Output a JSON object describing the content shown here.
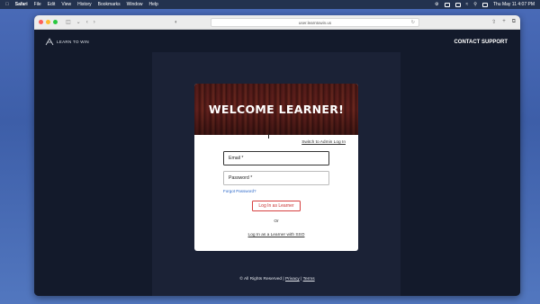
{
  "menubar": {
    "items": [
      "Safari",
      "File",
      "Edit",
      "View",
      "History",
      "Bookmarks",
      "Window",
      "Help"
    ],
    "clock": "Thu May 11  4:07 PM"
  },
  "browser": {
    "url": "user.learntowin.us"
  },
  "site": {
    "logo_text": "LEARN TO WIN",
    "contact": "CONTACT SUPPORT"
  },
  "card": {
    "title": "WELCOME LEARNER!",
    "switch_link": "Switch to Admin Log In",
    "email_label": "Email *",
    "password_label": "Password *",
    "forgot": "Forgot Password?",
    "login_button": "Log In as Learner",
    "or": "Or",
    "sso": "Log In as a Learner with SSO"
  },
  "footer": {
    "copyright": "© All Rights Reserved |",
    "privacy": "Privacy",
    "separator": "|",
    "terms": "Terms"
  },
  "colors": {
    "page_bg": "#131a2b",
    "panel_bg": "#1b2236",
    "accent_red": "#c83030",
    "link_blue": "#2a67c9"
  }
}
